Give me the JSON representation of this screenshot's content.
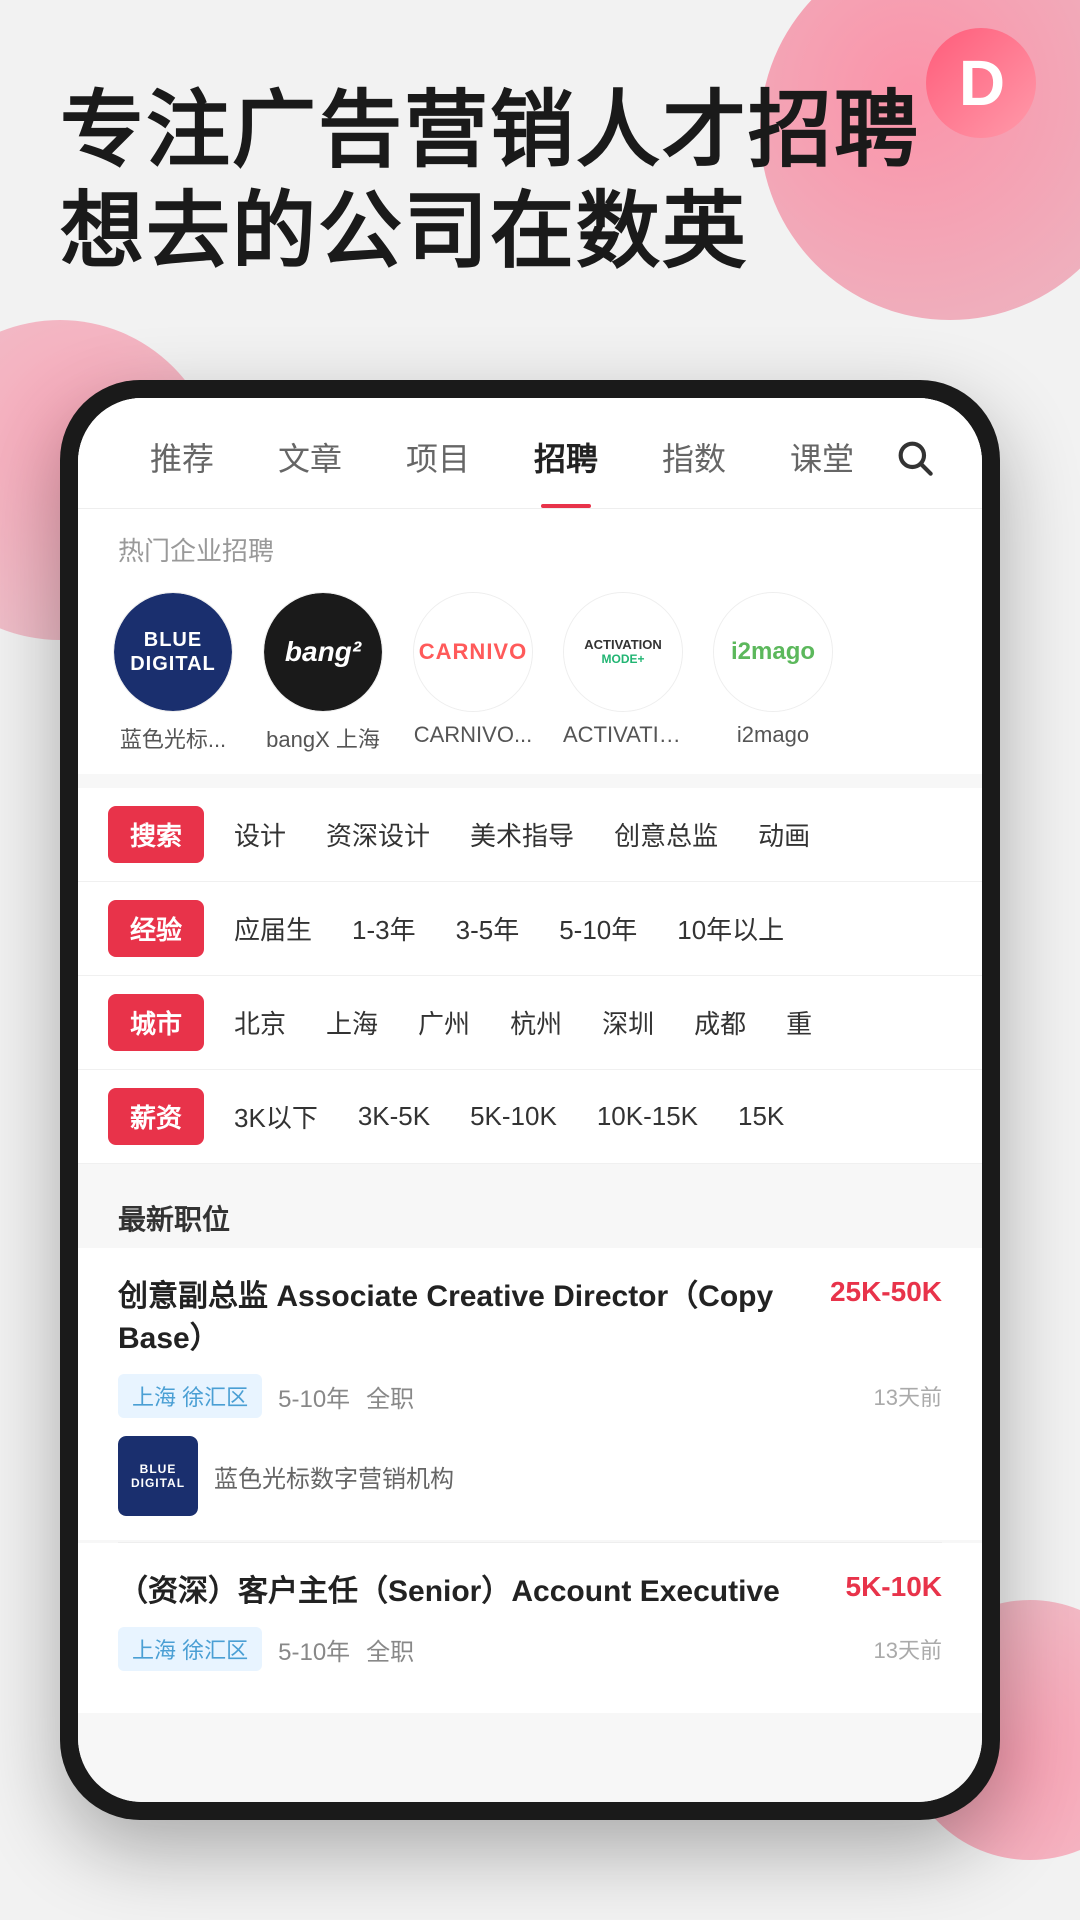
{
  "app": {
    "logo_letter": "D",
    "hero_line1": "专注广告营销人才招聘",
    "hero_line2": "想去的公司在数英"
  },
  "nav": {
    "tabs": [
      {
        "label": "推荐",
        "active": false
      },
      {
        "label": "文章",
        "active": false
      },
      {
        "label": "项目",
        "active": false
      },
      {
        "label": "招聘",
        "active": true
      },
      {
        "label": "指数",
        "active": false
      },
      {
        "label": "课堂",
        "active": false
      }
    ],
    "search_icon": "search-icon"
  },
  "hot_companies": {
    "label": "热门企业招聘",
    "items": [
      {
        "name": "蓝色光标...",
        "logo_type": "blue_digital"
      },
      {
        "name": "bangX 上海",
        "logo_type": "bangx"
      },
      {
        "name": "CARNIVO...",
        "logo_type": "carnivo"
      },
      {
        "name": "ACTIVATIO...",
        "logo_type": "activation"
      },
      {
        "name": "i2mago",
        "logo_type": "i2mago"
      }
    ]
  },
  "filters": [
    {
      "tag": "搜索",
      "options": [
        "设计",
        "资深设计",
        "美术指导",
        "创意总监",
        "动画"
      ]
    },
    {
      "tag": "经验",
      "options": [
        "应届生",
        "1-3年",
        "3-5年",
        "5-10年",
        "10年以上"
      ]
    },
    {
      "tag": "城市",
      "options": [
        "北京",
        "上海",
        "广州",
        "杭州",
        "深圳",
        "成都",
        "重"
      ]
    },
    {
      "tag": "薪资",
      "options": [
        "3K以下",
        "3K-5K",
        "5K-10K",
        "10K-15K",
        "15K"
      ]
    }
  ],
  "jobs": {
    "section_label": "最新职位",
    "items": [
      {
        "title": "创意副总监 Associate Creative Director（Copy Base）",
        "salary": "25K-50K",
        "location": "上海 徐汇区",
        "experience": "5-10年",
        "job_type": "全职",
        "date": "13天前",
        "company_name": "蓝色光标数字营销机构",
        "company_logo_type": "blue_digital"
      },
      {
        "title": "（资深）客户主任（Senior）Account Executive",
        "salary": "5K-10K",
        "location": "上海 徐汇区",
        "experience": "5-10年",
        "job_type": "全职",
        "date": "13天前",
        "company_name": "",
        "company_logo_type": ""
      }
    ]
  },
  "colors": {
    "primary_red": "#e8334a",
    "blue_digital_bg": "#1a2f6e",
    "bangx_bg": "#1a1a1a",
    "text_dark": "#222222",
    "text_gray": "#888888"
  }
}
